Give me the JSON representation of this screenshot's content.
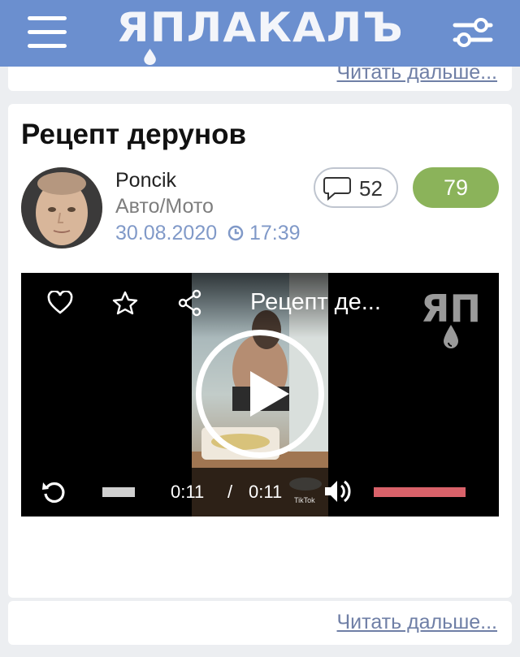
{
  "header": {
    "logo_text": "ЯПЛАКАЛЪ",
    "menu_icon": "hamburger-icon",
    "filter_icon": "sliders-icon",
    "bg_color": "#6b8fcf"
  },
  "prev_post": {
    "read_more": "Читать дальше..."
  },
  "post": {
    "title": "Рецепт дерунов",
    "author": "Poncik",
    "category": "Авто/Мото",
    "date": "30.08.2020",
    "time": "17:39",
    "comments_count": "52",
    "rating": "79",
    "rating_color": "#8bb35a",
    "video": {
      "title": "Рецепт де...",
      "current_time": "0:11",
      "separator": "/",
      "duration": "0:11",
      "watermark": "ЯП",
      "tiktok_label": "TikTok",
      "progress": 1.0,
      "volume": 1.0
    },
    "read_more": "Читать дальше..."
  }
}
